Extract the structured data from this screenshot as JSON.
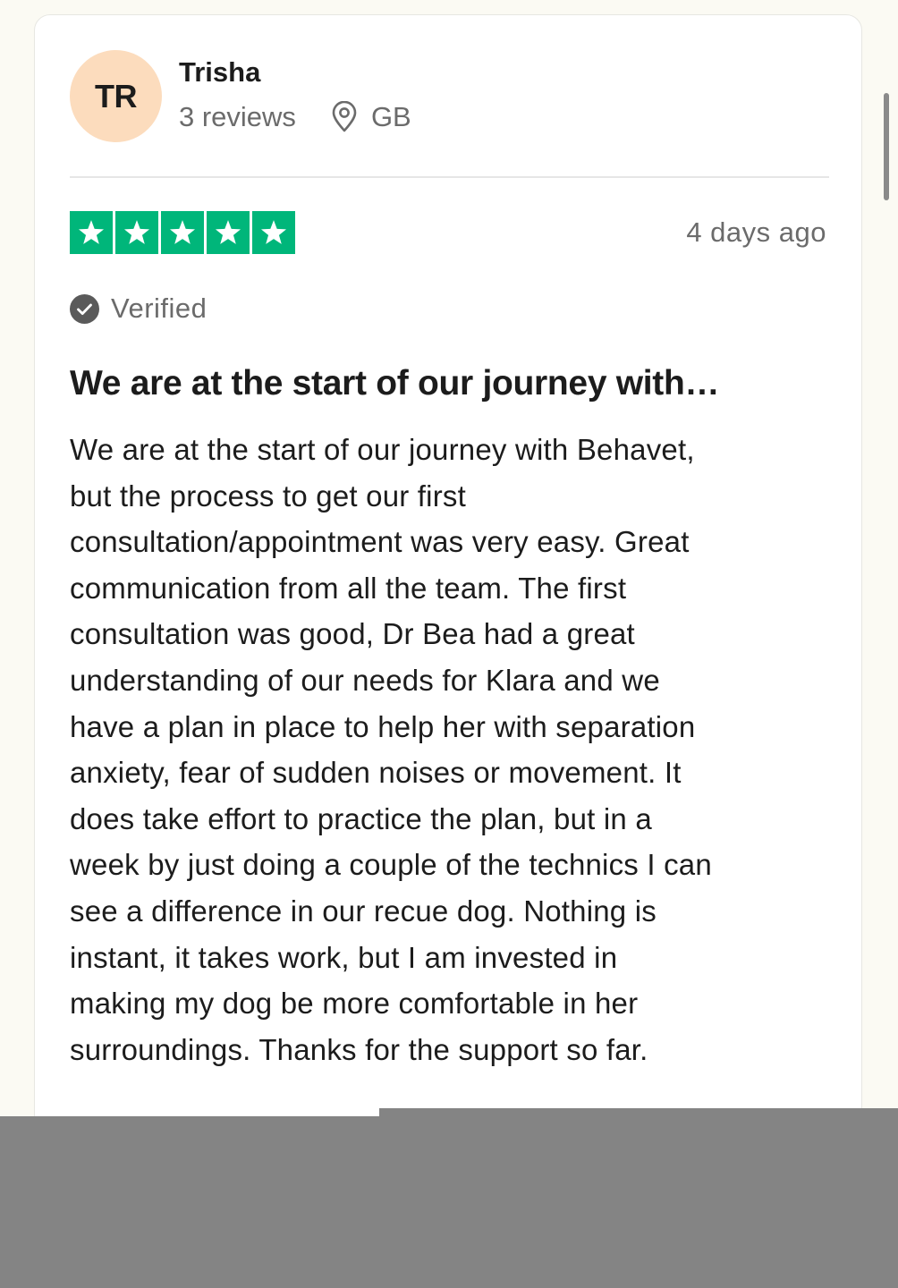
{
  "reviewer": {
    "initials": "TR",
    "name": "Trisha",
    "reviews_count": "3 reviews",
    "location": "GB",
    "avatar_color": "#fcdcbd",
    "location_icon": "location-pin-icon"
  },
  "review": {
    "rating": 5,
    "max_rating": 5,
    "star_color": "#00b67a",
    "date": "4 days ago",
    "verified_label": "Verified",
    "verified_icon": "check-circle-icon",
    "title": "We are at the start of our journey with…",
    "body_lines": [
      "We are at the start of our journey with Behavet,",
      "but the process to get our first",
      "consultation/appointment was very easy. Great",
      "communication from all the team. The first",
      "consultation was good, Dr Bea had a great",
      "understanding of our needs for Klara and we",
      "have a plan in place to help her with separation",
      "anxiety, fear of sudden noises or movement. It",
      "does take effort to practice the plan, but in a",
      "week by just doing a couple of the technics I can",
      "see a difference in our recue dog. Nothing is",
      "instant, it takes work, but I am invested in",
      "making my dog be more comfortable in her",
      "surroundings. Thanks for the support so far."
    ]
  }
}
